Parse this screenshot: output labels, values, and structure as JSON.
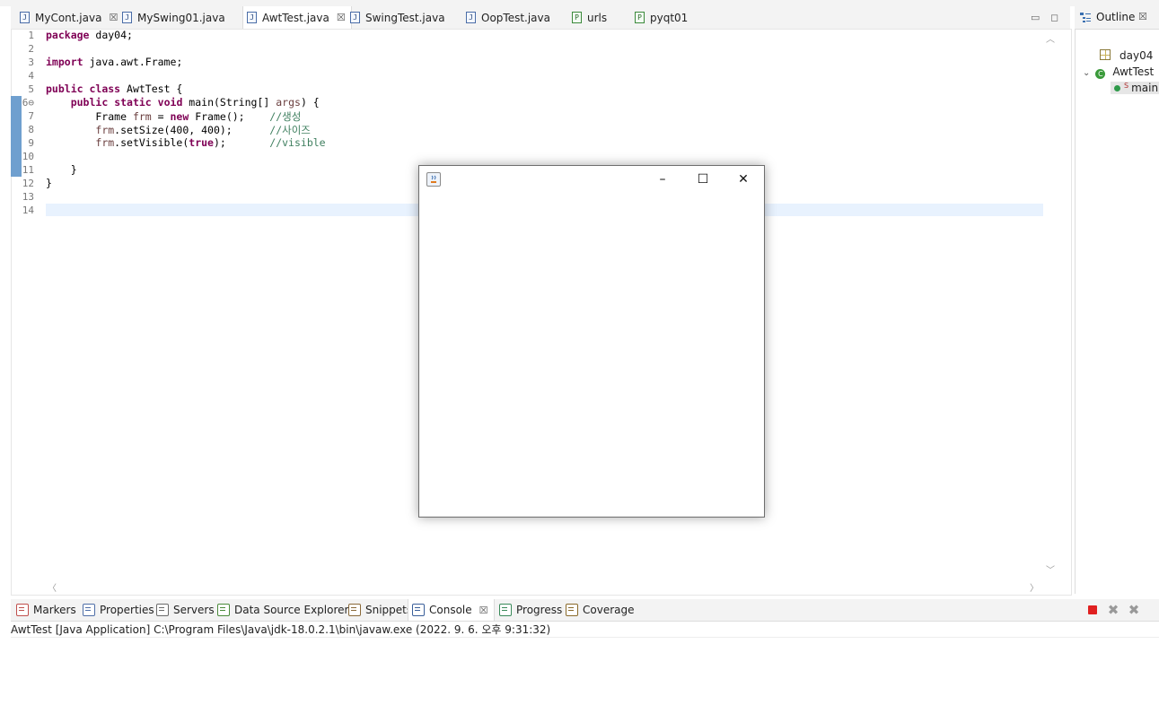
{
  "editor_tabs": [
    {
      "label": "MyCont.java",
      "icon": "java-file-icon",
      "icon_glyph": "J",
      "closable": true,
      "active": false
    },
    {
      "label": "MySwing01.java",
      "icon": "java-file-icon",
      "icon_glyph": "J",
      "closable": false,
      "active": false
    },
    {
      "label": "AwtTest.java",
      "icon": "java-file-icon",
      "icon_glyph": "J",
      "closable": true,
      "active": true
    },
    {
      "label": "SwingTest.java",
      "icon": "java-file-icon",
      "icon_glyph": "J",
      "closable": false,
      "active": false
    },
    {
      "label": "OopTest.java",
      "icon": "java-file-icon",
      "icon_glyph": "J",
      "closable": false,
      "active": false
    },
    {
      "label": "urls",
      "icon": "python-file-icon",
      "icon_glyph": "P",
      "closable": false,
      "active": false
    },
    {
      "label": "pyqt01",
      "icon": "python-file-icon",
      "icon_glyph": "P",
      "closable": false,
      "active": false
    }
  ],
  "close_glyph": "☒",
  "code_lines": [
    {
      "num": "1",
      "text": "package day04;"
    },
    {
      "num": "2",
      "text": ""
    },
    {
      "num": "3",
      "text": "import java.awt.Frame;"
    },
    {
      "num": "4",
      "text": ""
    },
    {
      "num": "5",
      "text": "public class AwtTest {"
    },
    {
      "num": "6⊖",
      "text": "    public static void main(String[] args) {"
    },
    {
      "num": "7",
      "text": "        Frame frm = new Frame();    //생성"
    },
    {
      "num": "8",
      "text": "        frm.setSize(400, 400);      //사이즈"
    },
    {
      "num": "9",
      "text": "        frm.setVisible(true);       //visible"
    },
    {
      "num": "10",
      "text": ""
    },
    {
      "num": "11",
      "text": "    }"
    },
    {
      "num": "12",
      "text": "}"
    },
    {
      "num": "13",
      "text": ""
    },
    {
      "num": "14",
      "text": ""
    }
  ],
  "outline": {
    "title": "Outline",
    "items": [
      {
        "label": "day04",
        "icon": "package-icon"
      },
      {
        "label": "AwtTest",
        "icon": "class-icon"
      },
      {
        "label": "main",
        "icon": "method-icon"
      }
    ]
  },
  "console_tabs": [
    {
      "label": "Markers",
      "icon": "markers-icon",
      "color": "#c0504d",
      "active": false
    },
    {
      "label": "Properties",
      "icon": "properties-icon",
      "color": "#4f6fa8",
      "active": false
    },
    {
      "label": "Servers",
      "icon": "servers-icon",
      "color": "#6a6a6a",
      "active": false
    },
    {
      "label": "Data Source Explorer",
      "icon": "database-icon",
      "color": "#4a8a3a",
      "active": false
    },
    {
      "label": "Snippets",
      "icon": "snippets-icon",
      "color": "#8a6a3a",
      "active": false
    },
    {
      "label": "Console",
      "icon": "console-icon",
      "color": "#3a5f9a",
      "active": true
    },
    {
      "label": "Progress",
      "icon": "progress-icon",
      "color": "#3a8a5a",
      "active": false
    },
    {
      "label": "Coverage",
      "icon": "coverage-icon",
      "color": "#8a6a2a",
      "active": false
    }
  ],
  "console_status": "AwtTest [Java Application] C:\\Program Files\\Java\\jdk-18.0.2.1\\bin\\javaw.exe  (2022. 9. 6. 오후 9:31:32)",
  "toolbar": {
    "terminate_color": "#e02020"
  },
  "awt_frame": {
    "minimize_glyph": "–",
    "maximize_glyph": "☐",
    "close_glyph": "✕"
  },
  "view_controls": {
    "minimize_glyph": "▭",
    "maximize_glyph": "◻"
  }
}
